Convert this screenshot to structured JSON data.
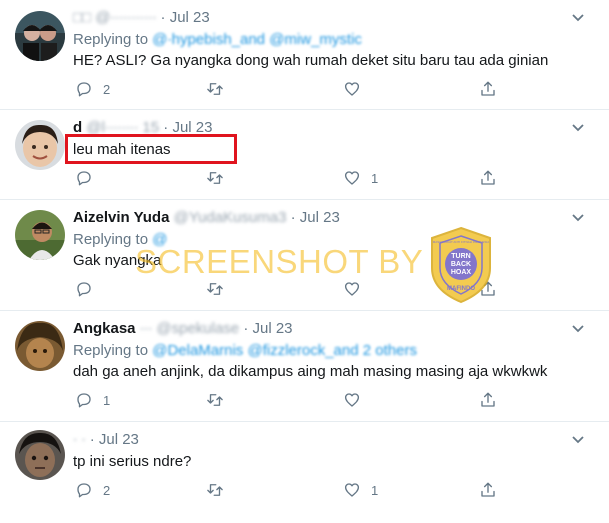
{
  "tweets": [
    {
      "name": "",
      "handle_obscured": "□□ @∙∙∙∙∙∙∙∙∙∙∙",
      "time": "Jul 23",
      "replying_label": "Replying to",
      "mentions": "@∙hypebish_and @miw_mystic",
      "text": "HE? ASLI? Ga nyangka dong wah rumah deket situ baru tau ada ginian",
      "replies": "2",
      "retweets": "",
      "likes": ""
    },
    {
      "name": "d",
      "handle_obscured": "@l∙∙∙∙∙∙∙∙ 15",
      "time": "Jul 23",
      "replying_label": "",
      "mentions": "",
      "text": "leu mah itenas",
      "replies": "",
      "retweets": "",
      "likes": "1"
    },
    {
      "name": "Aizelvin Yuda",
      "handle_obscured": "@YudaKusuma3",
      "time": "Jul 23",
      "replying_label": "Replying to",
      "mentions": "@",
      "text": "Gak nyangka",
      "replies": "",
      "retweets": "",
      "likes": ""
    },
    {
      "name": "Angkasa",
      "handle_obscured": "∙∙∙ @spekulase",
      "time": "Jul 23",
      "replying_label": "Replying to",
      "mentions": "@DelaMarnis @fizzlerock_and 2 others",
      "text": "dah ga aneh anjink, da dikampus aing mah masing masing aja wkwkwk",
      "replies": "1",
      "retweets": "",
      "likes": ""
    },
    {
      "name": "",
      "handle_obscured": "∙ ∙",
      "time": "Jul 23",
      "replying_label": "",
      "mentions": "",
      "text": "tp ini serius ndre?",
      "replies": "2",
      "retweets": "",
      "likes": "1"
    }
  ],
  "watermark": {
    "text": "SCREENSHOT BY",
    "badge_lines": [
      "MASYARAKAT ANTI FITNAH INDONESIA",
      "TURN",
      "BACK",
      "HOAX",
      "MAFINDO"
    ]
  },
  "colors": {
    "secondary_text": "#657786",
    "link": "#1b95e0",
    "highlight_box": "#e0141e",
    "watermark": "#f5be28"
  }
}
